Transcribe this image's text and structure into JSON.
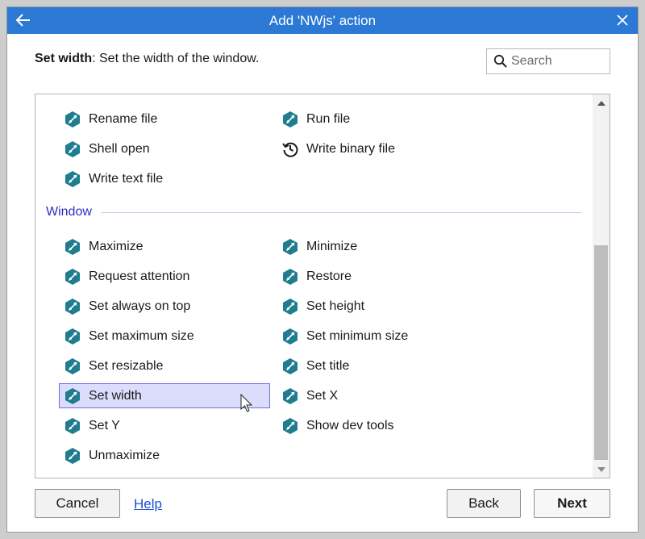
{
  "window": {
    "title": "Add 'NWjs' action"
  },
  "description": {
    "bold": "Set width",
    "text": ": Set the width of the window."
  },
  "search": {
    "placeholder": "Search",
    "value": ""
  },
  "file_items": [
    {
      "label": "Rename file",
      "icon": "nwjs-icon"
    },
    {
      "label": "Run file",
      "icon": "nwjs-icon"
    },
    {
      "label": "Shell open",
      "icon": "nwjs-icon"
    },
    {
      "label": "Write binary file",
      "icon": "history-icon"
    },
    {
      "label": "Write text file",
      "icon": "nwjs-icon"
    }
  ],
  "window_section": {
    "title": "Window",
    "items": [
      {
        "label": "Maximize"
      },
      {
        "label": "Minimize"
      },
      {
        "label": "Request attention"
      },
      {
        "label": "Restore"
      },
      {
        "label": "Set always on top"
      },
      {
        "label": "Set height"
      },
      {
        "label": "Set maximum size"
      },
      {
        "label": "Set minimum size"
      },
      {
        "label": "Set resizable"
      },
      {
        "label": "Set title"
      },
      {
        "label": "Set width",
        "selected": true
      },
      {
        "label": "Set X"
      },
      {
        "label": "Set Y"
      },
      {
        "label": "Show dev tools"
      },
      {
        "label": "Unmaximize"
      }
    ]
  },
  "buttons": {
    "cancel": "Cancel",
    "help": "Help",
    "back": "Back",
    "next": "Next"
  },
  "colors": {
    "titlebar": "#2b79d4",
    "icon": "#1f7d8f",
    "selection": "#dcdcfc",
    "section_title": "#2b2fc1",
    "link": "#1b4fd8"
  }
}
